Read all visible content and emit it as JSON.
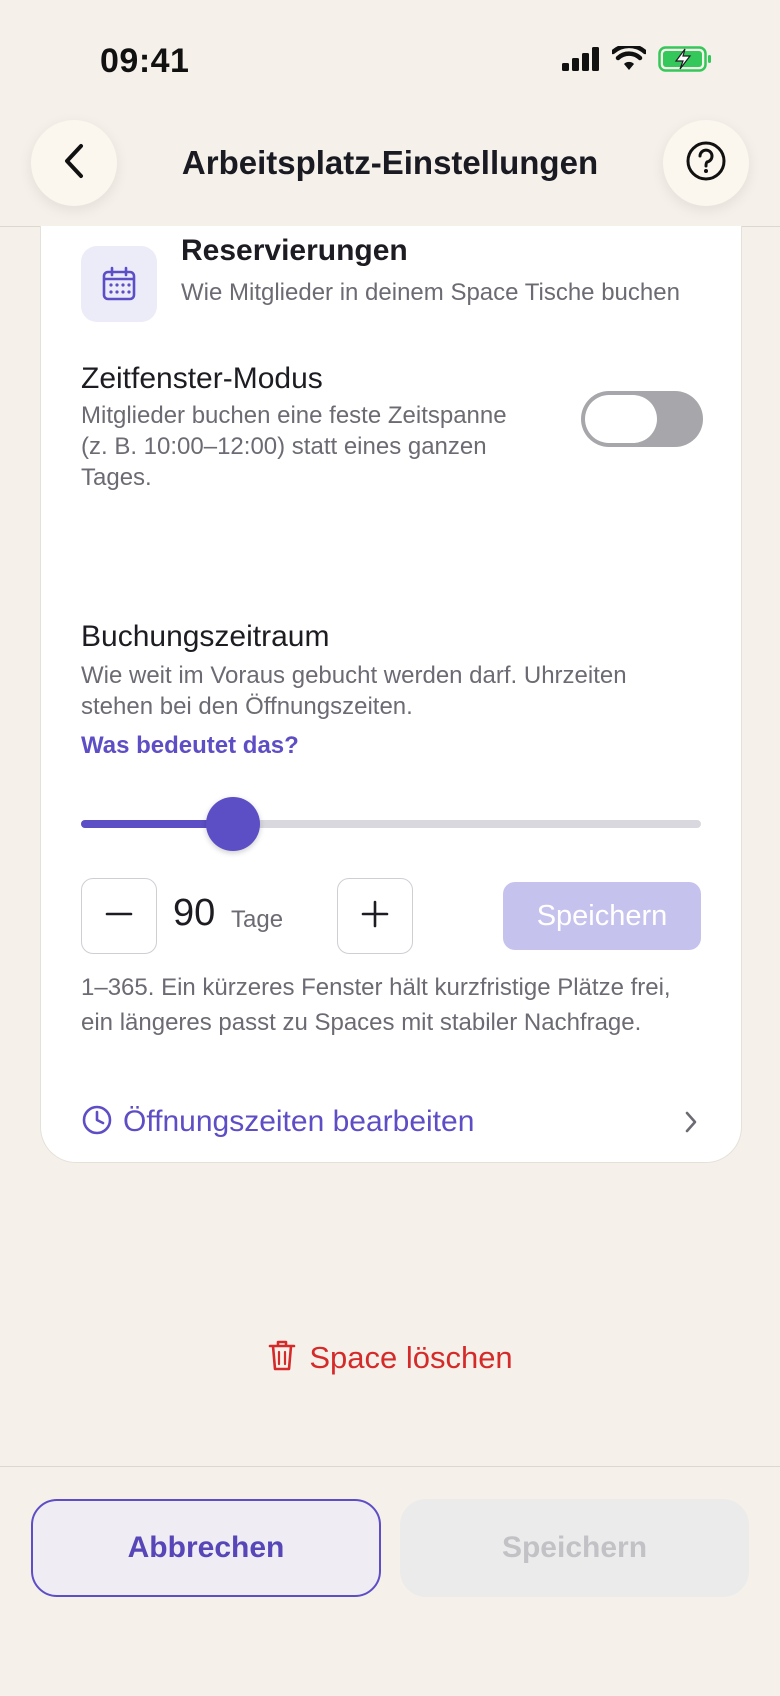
{
  "status_bar": {
    "time": "09:41",
    "icons": [
      "signal-icon",
      "wifi-icon",
      "battery-charging-icon"
    ],
    "battery_color": "#34c759"
  },
  "header": {
    "title": "Arbeitsplatz-Einstellungen",
    "back_icon": "chevron-left-icon",
    "help_icon": "question-circle-icon"
  },
  "reservations": {
    "icon": "calendar-icon",
    "title": "Reservierungen",
    "subtitle": "Wie Mitglieder in deinem Space Tische buchen"
  },
  "time_window": {
    "title": "Zeitfenster-Modus",
    "description": "Mitglieder buchen eine feste Zeitspanne (z. B. 10:00–12:00) statt eines ganzen Tages.",
    "enabled": false
  },
  "booking_period": {
    "title": "Buchungszeitraum",
    "description": "Wie weit im Voraus gebucht werden darf. Uhrzeiten stehen bei den Öffnungszeiten.",
    "help_link": "Was bedeutet das?",
    "value": "90",
    "unit": "Tage",
    "min": 1,
    "max": 365,
    "slider_value": 90,
    "save_label": "Speichern",
    "hint": "1–365. Ein kürzeres Fenster hält kurzfristige Plätze frei, ein längeres passt zu Spaces mit stabiler Nachfrage."
  },
  "opening_hours": {
    "icon": "clock-icon",
    "label": "Öffnungszeiten bearbeiten"
  },
  "delete": {
    "icon": "trash-icon",
    "label": "Space löschen"
  },
  "footer": {
    "cancel_label": "Abbrechen",
    "save_label": "Speichern"
  },
  "colors": {
    "accent": "#5c4fc6",
    "danger": "#d52a2a",
    "background": "#f5f1ea"
  }
}
